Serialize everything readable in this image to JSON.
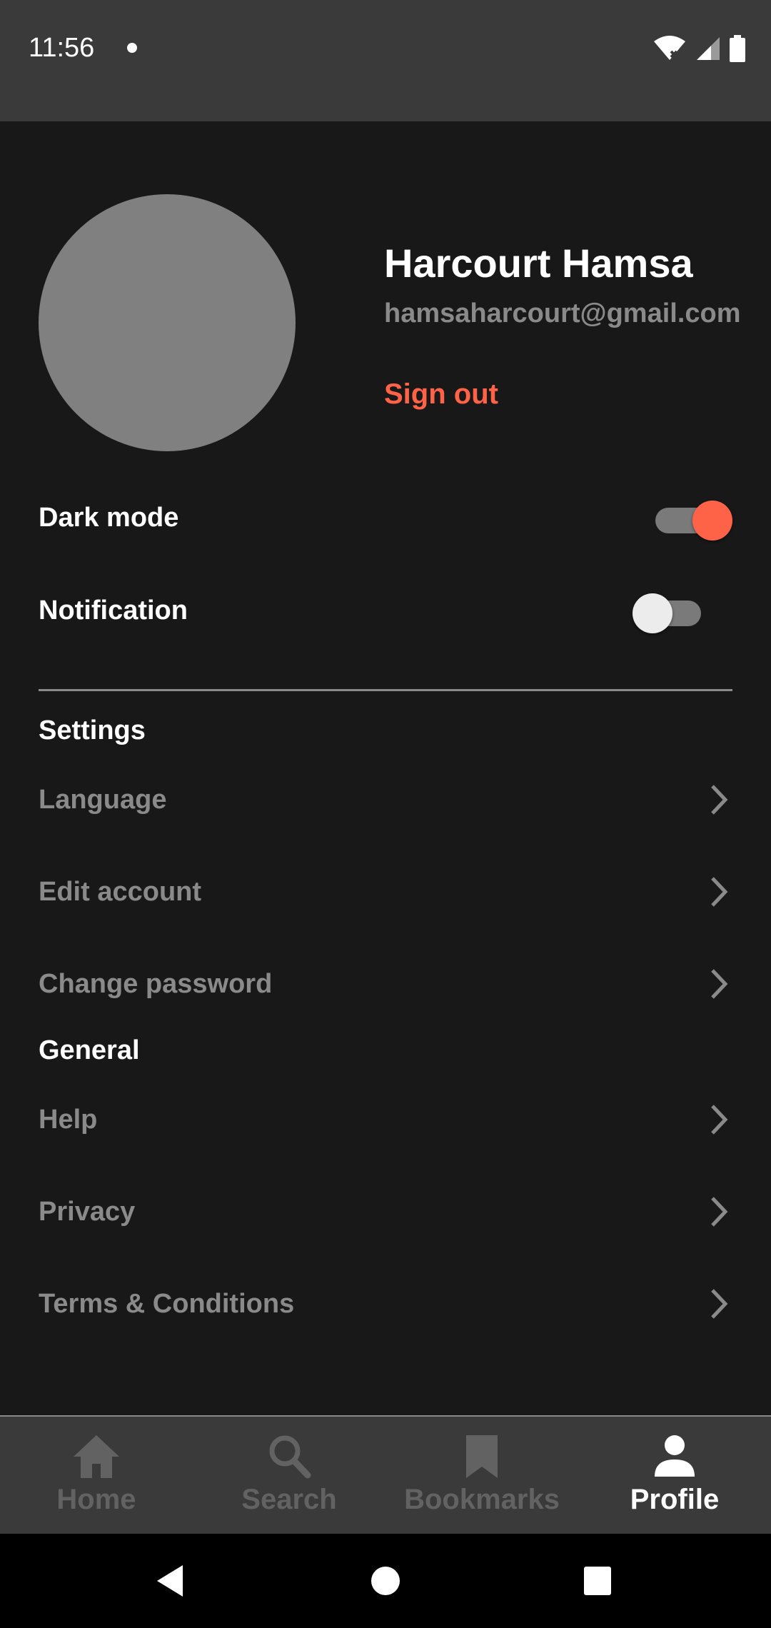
{
  "status_bar": {
    "time": "11:56",
    "icons": [
      "notification-dot-icon",
      "wifi-off-icon",
      "cell-signal-icon",
      "battery-icon"
    ]
  },
  "profile": {
    "name": "Harcourt Hamsa",
    "email": "hamsaharcourt@gmail.com",
    "sign_out_label": "Sign out"
  },
  "toggles": {
    "dark_mode": {
      "label": "Dark mode",
      "on": true
    },
    "notification": {
      "label": "Notification",
      "on": false
    }
  },
  "sections": {
    "settings": {
      "title": "Settings",
      "items": [
        {
          "label": "Language"
        },
        {
          "label": "Edit account"
        },
        {
          "label": "Change password"
        }
      ]
    },
    "general": {
      "title": "General",
      "items": [
        {
          "label": "Help"
        },
        {
          "label": "Privacy"
        },
        {
          "label": "Terms & Conditions"
        }
      ]
    }
  },
  "bottom_nav": {
    "items": [
      {
        "label": "Home",
        "icon": "home-icon",
        "active": false
      },
      {
        "label": "Search",
        "icon": "search-icon",
        "active": false
      },
      {
        "label": "Bookmarks",
        "icon": "bookmark-icon",
        "active": false
      },
      {
        "label": "Profile",
        "icon": "person-icon",
        "active": true
      }
    ]
  },
  "colors": {
    "background": "#181818",
    "accent": "#ff6347",
    "muted_text": "#8a8a8a",
    "bar": "#3a3a3a"
  }
}
